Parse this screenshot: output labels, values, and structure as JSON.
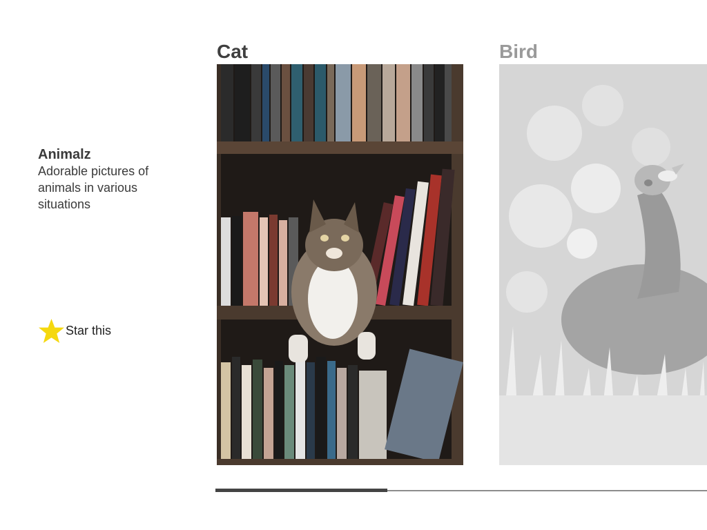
{
  "app": {
    "title": "Animalz",
    "description": "Adorable pictures of animals in various situations"
  },
  "actions": {
    "star_label": "Star this",
    "star_icon": "star-icon",
    "star_color": "#f5d80f"
  },
  "cards": [
    {
      "title": "Cat",
      "image": "cat-on-bookshelf-photo",
      "active": true
    },
    {
      "title": "Bird",
      "image": "peacock-in-grass-photo",
      "active": false
    }
  ],
  "progress": {
    "fraction": 0.35
  },
  "colors": {
    "text": "#3a3a3a",
    "inactive_text": "#9a9a9a",
    "progress_fill": "#444444",
    "progress_track": "#8c8c8c"
  }
}
